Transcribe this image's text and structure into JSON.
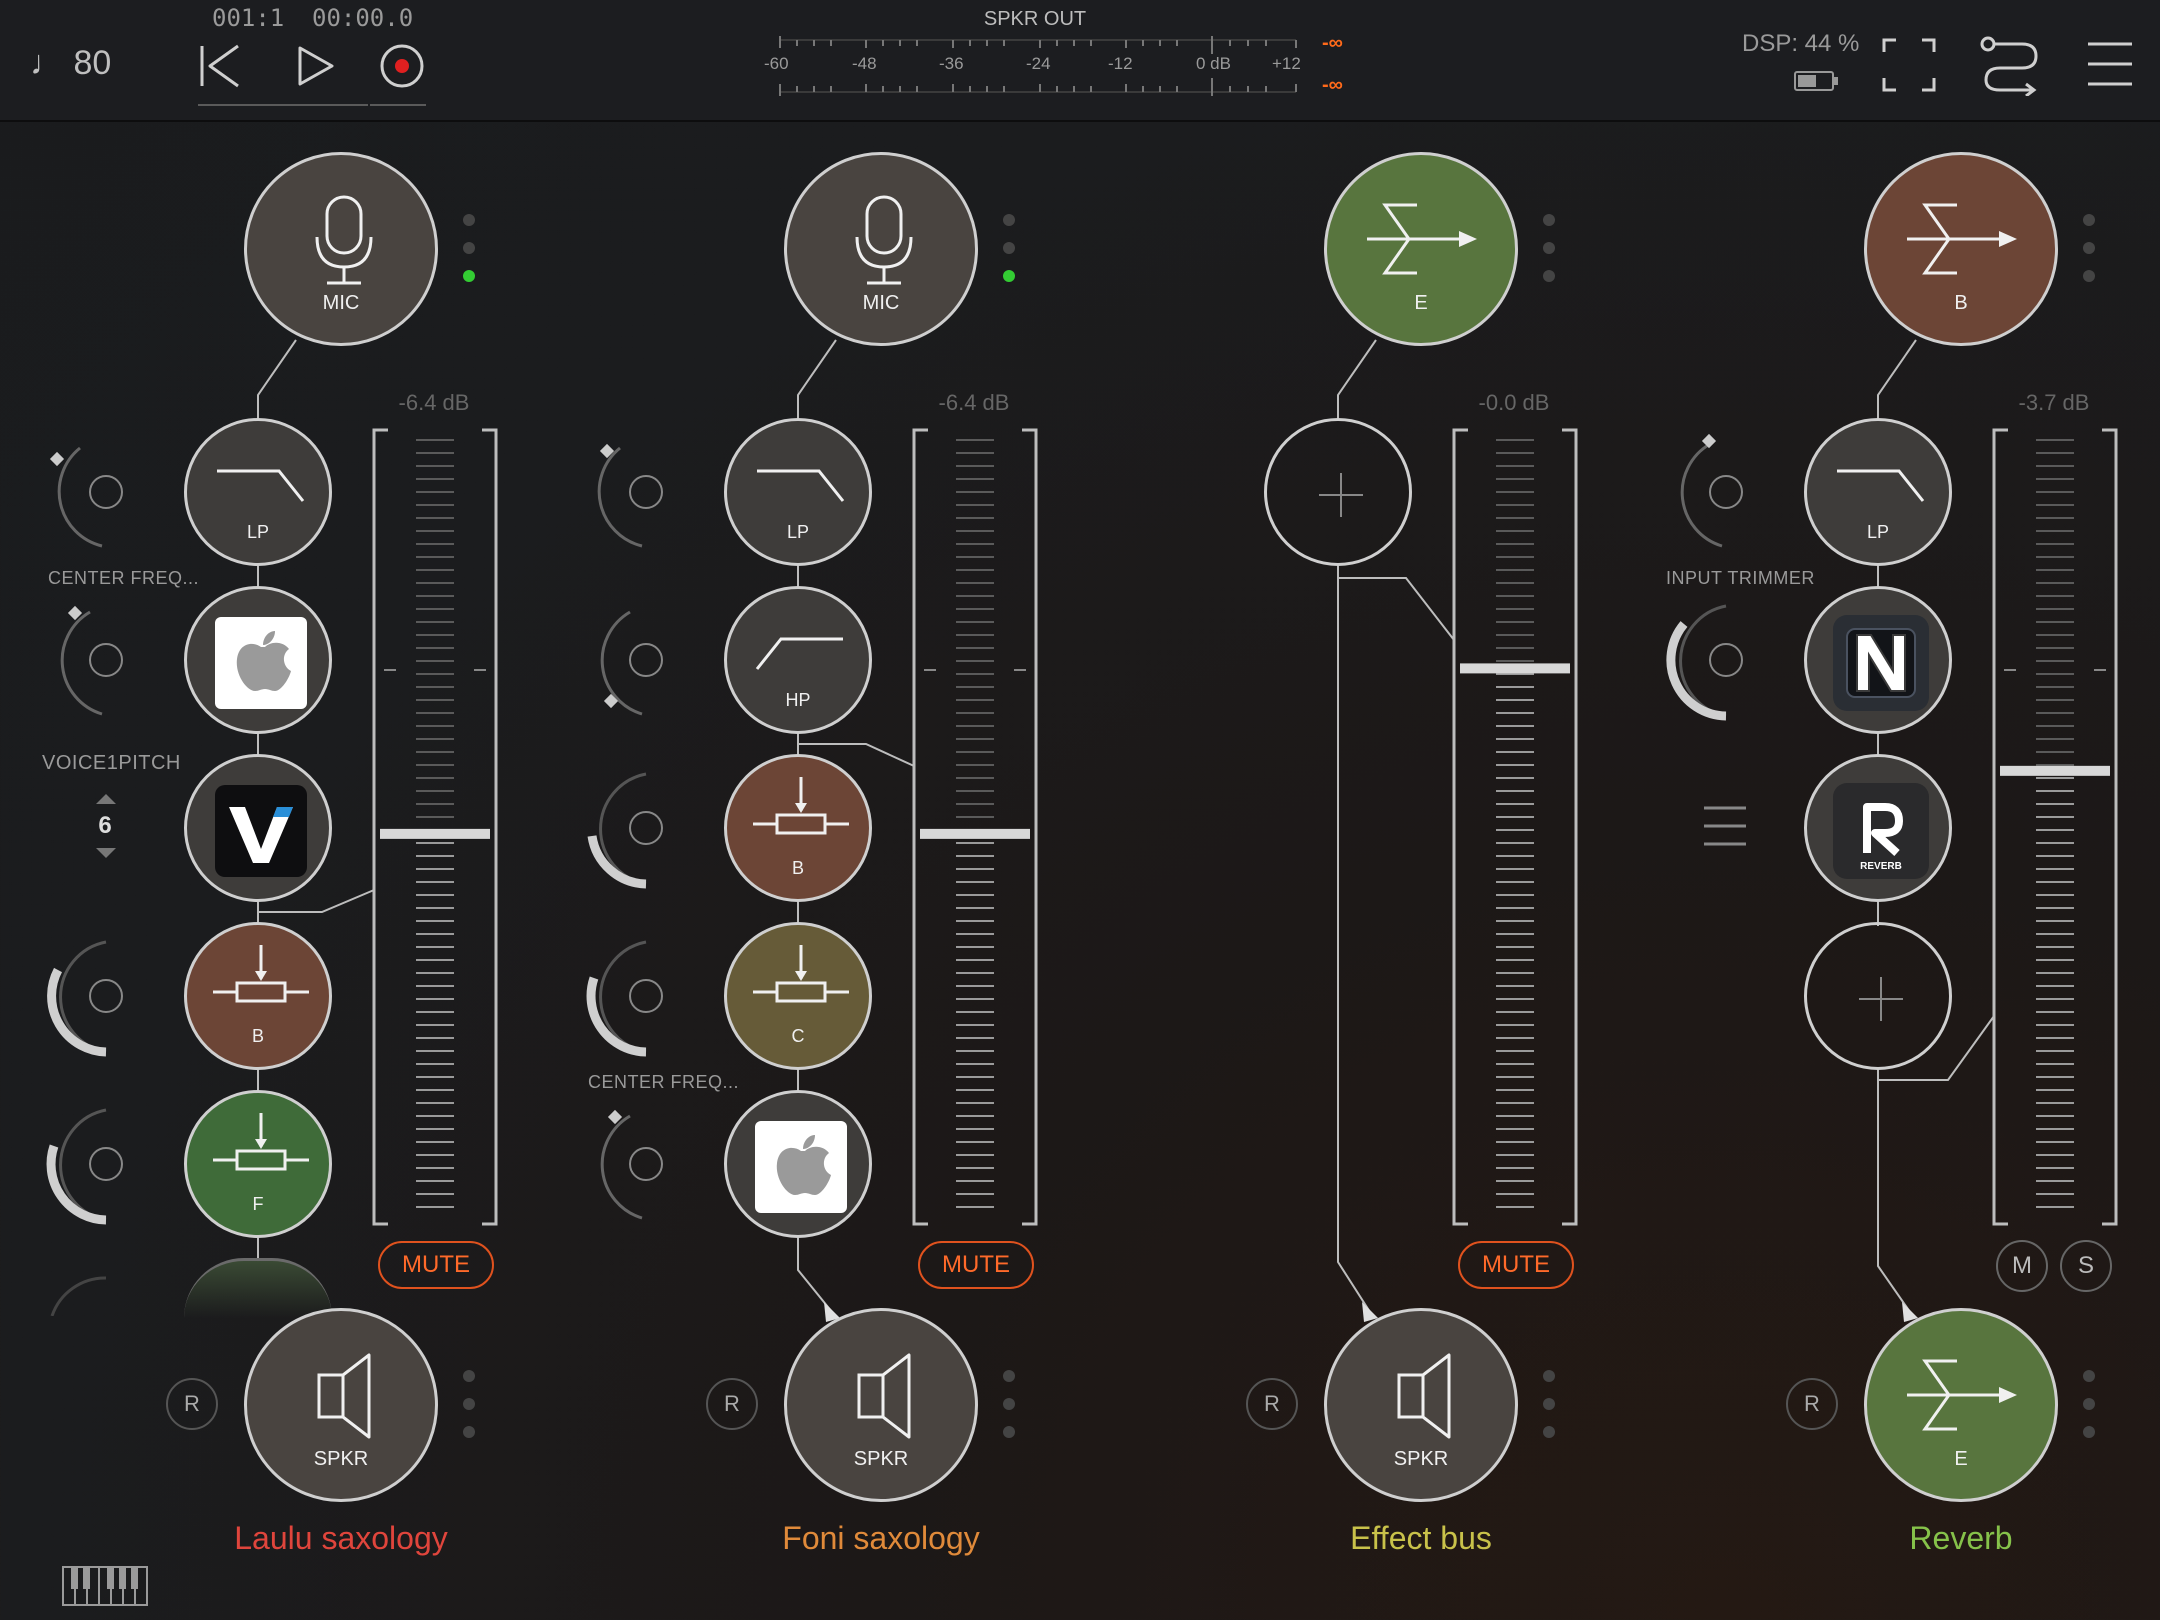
{
  "transport": {
    "tempo": "♩ 80",
    "bar_position": "001:1",
    "time_position": "00:00.0"
  },
  "master_meter": {
    "title": "SPKR OUT",
    "scale": [
      "-60",
      "-48",
      "-36",
      "-24",
      "-12",
      "0 dB",
      "+12"
    ],
    "peak_left": "-∞",
    "peak_right": "-∞"
  },
  "status": {
    "dsp": "DSP: 44 %"
  },
  "channels": [
    {
      "name": "Laulu saxology",
      "name_color": "#e0453c",
      "input": "MIC",
      "gain": "-6.4 dB",
      "fader_level": 0.49,
      "effects": [
        "LP",
        "",
        "",
        "B",
        "F"
      ],
      "param_labels": [
        "CENTER FREQ...",
        "VOICE1PITCH"
      ],
      "stepper_value": "6",
      "mute": "MUTE",
      "output": "SPKR",
      "record": "R"
    },
    {
      "name": "Foni saxology",
      "name_color": "#e08a3a",
      "input": "MIC",
      "gain": "-6.4 dB",
      "fader_level": 0.49,
      "effects": [
        "LP",
        "HP",
        "B",
        "C",
        ""
      ],
      "param_labels": [
        "CENTER FREQ..."
      ],
      "mute": "MUTE",
      "output": "SPKR",
      "record": "R"
    },
    {
      "name": "Effect bus",
      "name_color": "#c9c24a",
      "input": "E",
      "gain": "-0.0 dB",
      "fader_level": 0.7,
      "effects": [],
      "mute": "MUTE",
      "output": "SPKR",
      "record": "R"
    },
    {
      "name": "Reverb",
      "name_color": "#86c24a",
      "input": "B",
      "gain": "-3.7 dB",
      "fader_level": 0.57,
      "effects": [
        "LP",
        "",
        ""
      ],
      "param_labels": [
        "INPUT TRIMMER"
      ],
      "mute": "M",
      "solo": "S",
      "output": "E",
      "record": "R"
    }
  ],
  "colors": {
    "node_grey": "#494440",
    "bus_green": "#58753e",
    "bus_brown": "#6c4536",
    "fx_brown": "#6c4536",
    "fx_olive": "#665b38",
    "fx_green": "#3f6b39",
    "mute_orange": "#e0521e",
    "accent_green": "#33cc33"
  }
}
